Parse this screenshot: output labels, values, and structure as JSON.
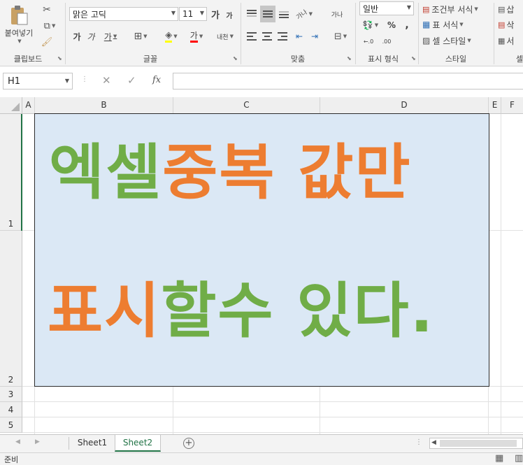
{
  "ribbon": {
    "clipboard": {
      "paste_label": "붙여넣기",
      "group_label": "클립보드"
    },
    "font": {
      "font_name": "맑은 고딕",
      "font_size": "11",
      "grow_label": "가",
      "shrink_label": "가",
      "bold_label": "가",
      "italic_label": "가",
      "underline_label": "가",
      "font_color_label": "가",
      "phonetic_label": "내천",
      "group_label": "글꼴"
    },
    "alignment": {
      "wrap_label": "가나",
      "orientation_label": "가나",
      "group_label": "맞춤"
    },
    "number": {
      "format_value": "일반",
      "percent_label": "%",
      "comma_label": ",",
      "inc_decimal_label": "←.0",
      "dec_decimal_label": ".00",
      "group_label": "표시 형식"
    },
    "styles": {
      "conditional_label": "조건부 서식",
      "table_format_label": "표 서식",
      "cell_style_label": "셀 스타일",
      "group_label": "스타일"
    },
    "cells": {
      "insert_label": "삽",
      "delete_label": "삭",
      "format_label": "서",
      "group_label": "셀"
    }
  },
  "formula_bar": {
    "name_box": "H1",
    "fx_label": "fx",
    "formula_value": ""
  },
  "grid": {
    "columns": [
      "A",
      "B",
      "C",
      "D",
      "E",
      "F"
    ],
    "rows": [
      "1",
      "2",
      "3",
      "4",
      "5"
    ]
  },
  "textbox": {
    "line1": [
      {
        "text": "엑셀",
        "color": "#70ad47"
      },
      {
        "text": "중복 값만",
        "color": "#ed7d31"
      }
    ],
    "line2": [
      {
        "text": "표시",
        "color": "#ed7d31"
      },
      {
        "text": "할수 있다.",
        "color": "#70ad47"
      }
    ],
    "fill_color": "#dbe8f5"
  },
  "sheets": {
    "tabs": [
      "Sheet1",
      "Sheet2"
    ],
    "active": "Sheet2",
    "add_label": "+"
  },
  "status": {
    "mode": "준비"
  },
  "colors": {
    "accent": "#217346",
    "green_text": "#70ad47",
    "orange_text": "#ed7d31"
  }
}
